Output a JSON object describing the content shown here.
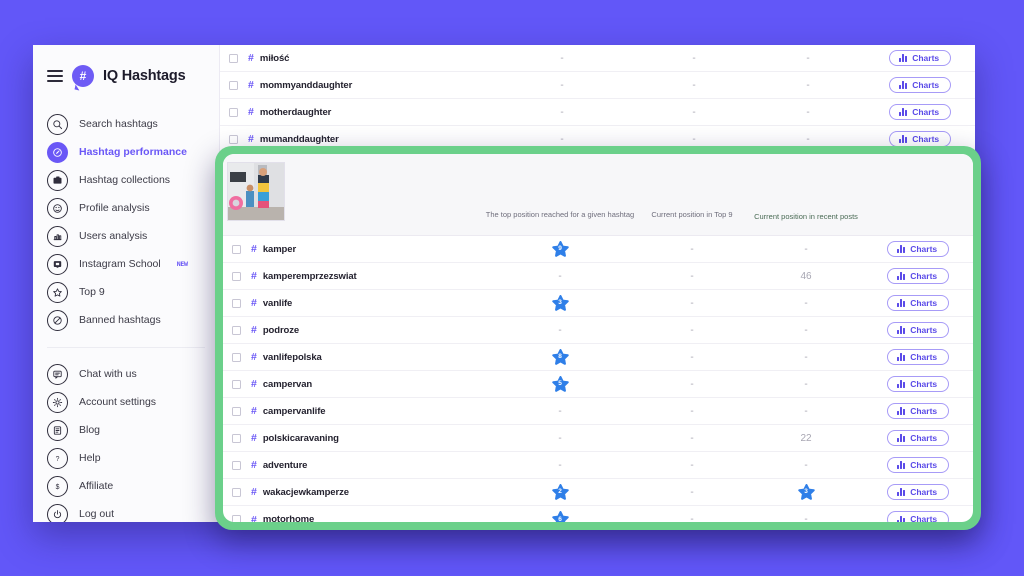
{
  "brand": {
    "iq": "IQ",
    "hashtags": "Hashtags"
  },
  "sidebar": {
    "primary": [
      {
        "label": "Search hashtags",
        "icon": "search-icon",
        "active": false
      },
      {
        "label": "Hashtag performance",
        "icon": "speedometer-icon",
        "active": true
      },
      {
        "label": "Hashtag collections",
        "icon": "folder-icon",
        "active": false
      },
      {
        "label": "Profile analysis",
        "icon": "face-icon",
        "active": false
      },
      {
        "label": "Users analysis",
        "icon": "users-chart-icon",
        "active": false
      },
      {
        "label": "Instagram School",
        "icon": "school-icon",
        "active": false,
        "badge": "NEW"
      },
      {
        "label": "Top 9",
        "icon": "star-icon",
        "active": false
      },
      {
        "label": "Banned hashtags",
        "icon": "ban-icon",
        "active": false
      }
    ],
    "secondary": [
      {
        "label": "Chat with us",
        "icon": "chat-icon"
      },
      {
        "label": "Account settings",
        "icon": "gear-icon"
      },
      {
        "label": "Blog",
        "icon": "book-icon"
      },
      {
        "label": "Help",
        "icon": "question-icon"
      },
      {
        "label": "Affiliate",
        "icon": "dollar-icon"
      },
      {
        "label": "Log out",
        "icon": "power-icon"
      }
    ]
  },
  "columns": {
    "top_position": "The top position reached for a given hashtag",
    "current_top9": "Current position in Top 9",
    "current_recent": "Current position in recent posts",
    "charts_button": "Charts"
  },
  "colors": {
    "page_background": "#6257f8",
    "accent": "#6a57f6",
    "highlight_green": "#6bd08a",
    "marker_green": "#a9dfbb",
    "star_blue": "#2f7fe8",
    "dash": "-"
  },
  "top_rows": [
    {
      "tag": "miłość",
      "top_position": "-",
      "top9": "-",
      "recent": "-",
      "button": "Charts"
    },
    {
      "tag": "mommyanddaughter",
      "top_position": "-",
      "top9": "-",
      "recent": "-",
      "button": "Charts"
    },
    {
      "tag": "motherdaughter",
      "top_position": "-",
      "top9": "-",
      "recent": "-",
      "button": "Charts"
    },
    {
      "tag": "mumanddaughter",
      "top_position": "-",
      "top9": "-",
      "recent": "-",
      "button": "Charts"
    }
  ],
  "highlight_rows": [
    {
      "tag": "kamper",
      "top_position": "9",
      "top_star": true,
      "top9": "-",
      "recent": "-",
      "recent_star": false,
      "button": "Charts"
    },
    {
      "tag": "kamperemprzezswiat",
      "top_position": "-",
      "top_star": false,
      "top9": "-",
      "recent": "46",
      "recent_star": false,
      "button": "Charts"
    },
    {
      "tag": "vanlife",
      "top_position": "3",
      "top_star": true,
      "top9": "-",
      "recent": "-",
      "recent_star": false,
      "button": "Charts"
    },
    {
      "tag": "podroze",
      "top_position": "-",
      "top_star": false,
      "top9": "-",
      "recent": "-",
      "recent_star": false,
      "button": "Charts"
    },
    {
      "tag": "vanlifepolska",
      "top_position": "8",
      "top_star": true,
      "top9": "-",
      "recent": "-",
      "recent_star": false,
      "button": "Charts"
    },
    {
      "tag": "campervan",
      "top_position": "5",
      "top_star": true,
      "top9": "-",
      "recent": "-",
      "recent_star": false,
      "button": "Charts"
    },
    {
      "tag": "campervanlife",
      "top_position": "-",
      "top_star": false,
      "top9": "-",
      "recent": "-",
      "recent_star": false,
      "button": "Charts"
    },
    {
      "tag": "polskicaravaning",
      "top_position": "-",
      "top_star": false,
      "top9": "-",
      "recent": "22",
      "recent_star": false,
      "button": "Charts"
    },
    {
      "tag": "adventure",
      "top_position": "-",
      "top_star": false,
      "top9": "-",
      "recent": "-",
      "recent_star": false,
      "button": "Charts"
    },
    {
      "tag": "wakacjewkamperze",
      "top_position": "2",
      "top_star": true,
      "top9": "-",
      "recent": "3",
      "recent_star": true,
      "button": "Charts"
    },
    {
      "tag": "motorhome",
      "top_position": "6",
      "top_star": true,
      "top9": "-",
      "recent": "-",
      "recent_star": false,
      "button": "Charts"
    }
  ]
}
